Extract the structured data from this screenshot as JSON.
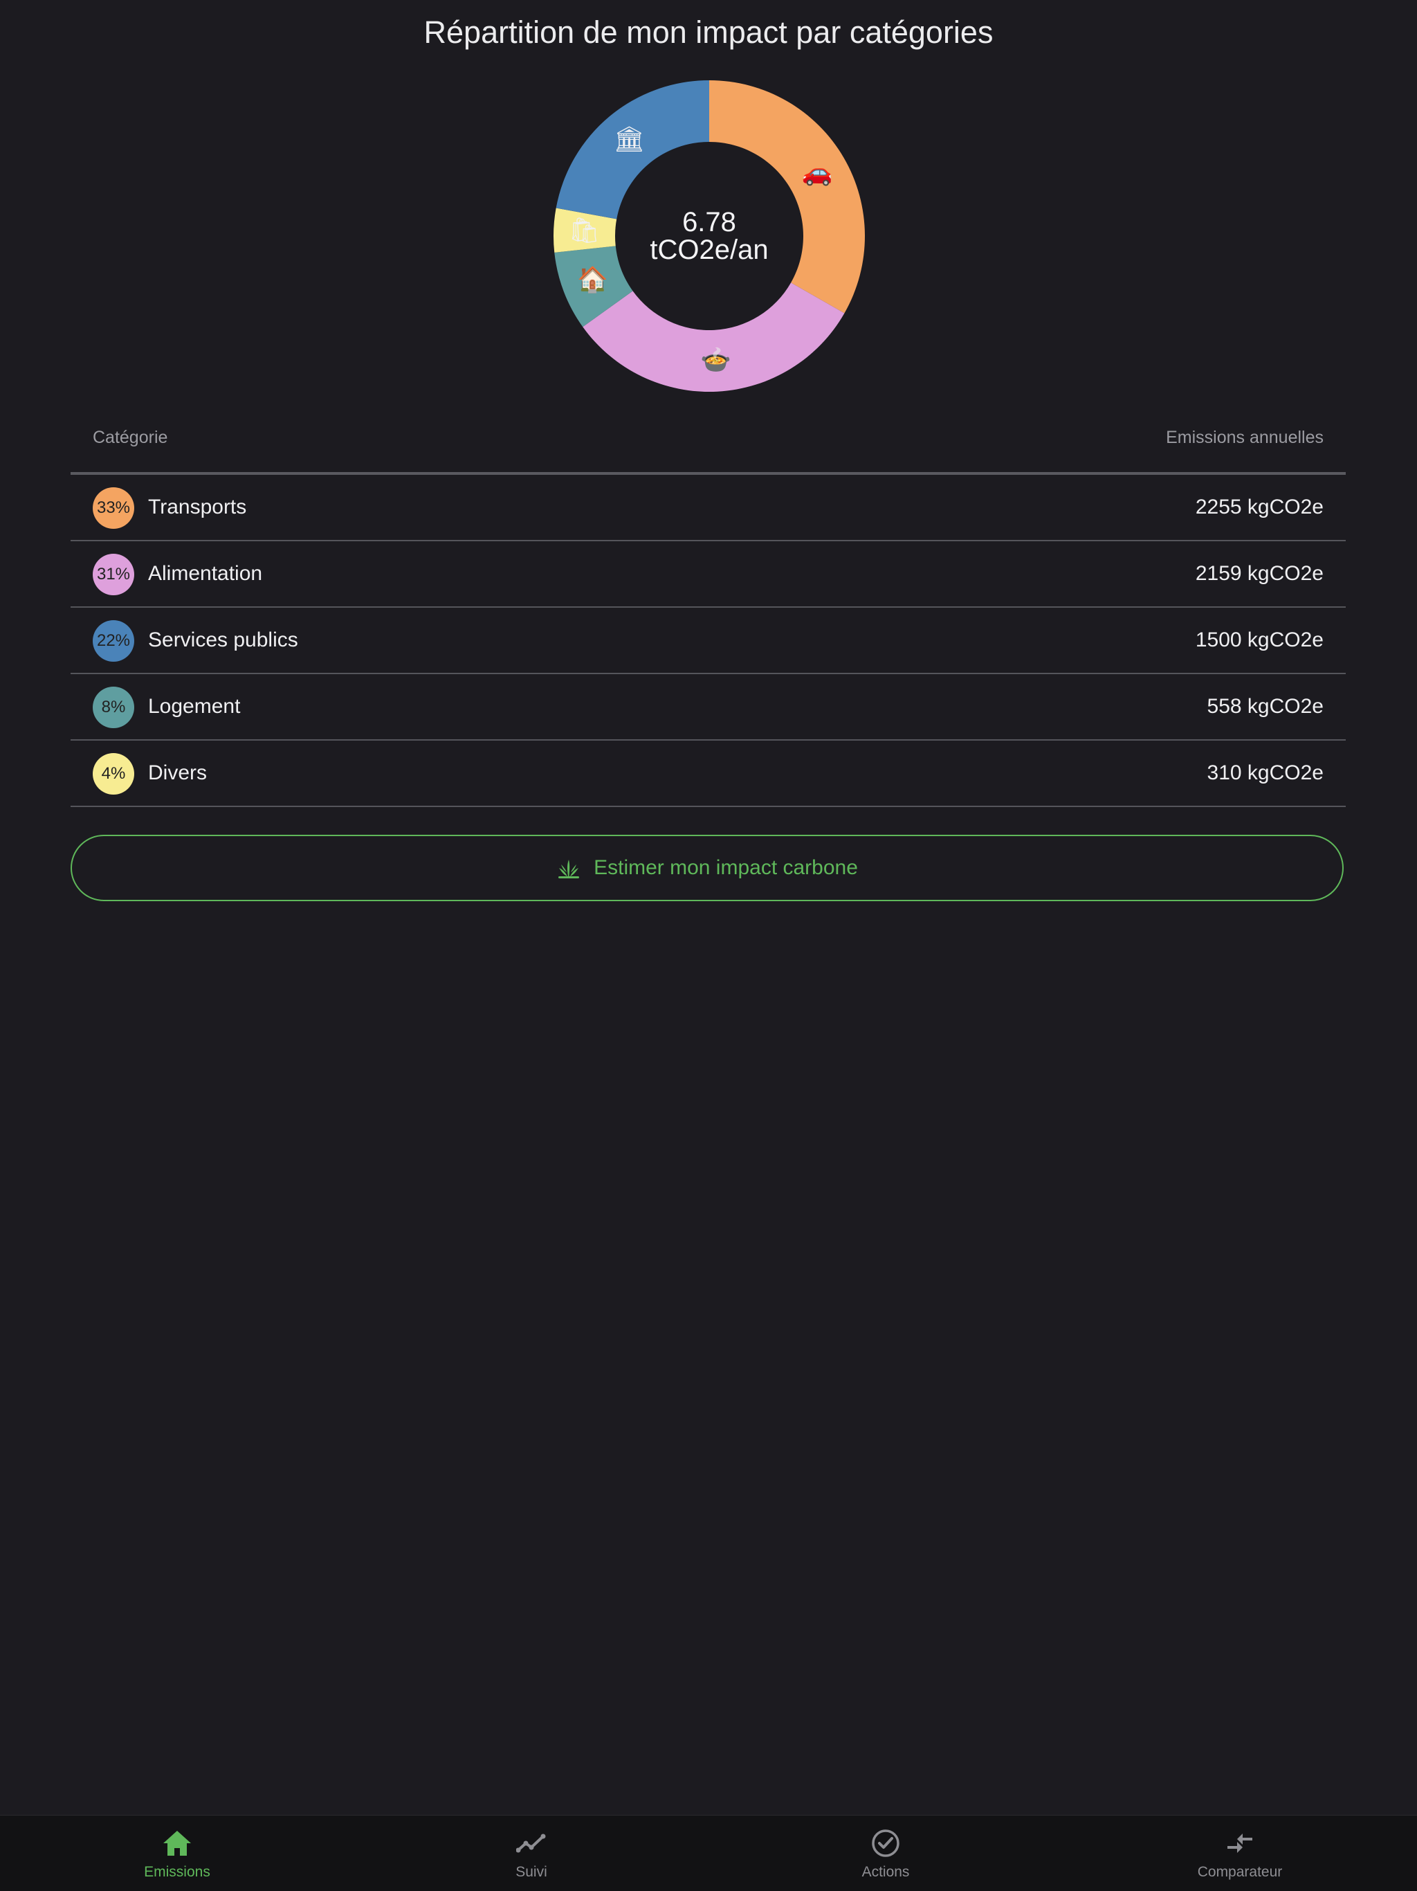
{
  "header": {
    "title": "Répartition de mon impact par catégories"
  },
  "chart_data": {
    "type": "pie",
    "variant": "donut",
    "center_value": "6.78",
    "center_unit": "tCO2e/an",
    "slices": [
      {
        "label": "Transports",
        "value": 2255,
        "percent": 33,
        "color": "#f4a461",
        "icon": "car-icon",
        "glyph": "🚗"
      },
      {
        "label": "Alimentation",
        "value": 2159,
        "percent": 31,
        "color": "#dea0dc",
        "icon": "food-bowl-icon",
        "glyph": "🍲"
      },
      {
        "label": "Logement",
        "value": 558,
        "percent": 8,
        "color": "#5f9ea0",
        "icon": "house-icon",
        "glyph": "🏠"
      },
      {
        "label": "Divers",
        "value": 310,
        "percent": 4,
        "color": "#f7ec92",
        "icon": "shopping-bags-icon",
        "glyph": "🛍"
      },
      {
        "label": "Services publics",
        "value": 1500,
        "percent": 22,
        "color": "#4a83b9",
        "icon": "public-building-icon",
        "glyph": "🏛"
      }
    ]
  },
  "table": {
    "col_category": "Catégorie",
    "col_emissions": "Emissions annuelles",
    "rows": [
      {
        "percent": "33%",
        "label": "Transports",
        "value": "2255 kgCO2e",
        "color": "#f4a461"
      },
      {
        "percent": "31%",
        "label": "Alimentation",
        "value": "2159 kgCO2e",
        "color": "#dea0dc"
      },
      {
        "percent": "22%",
        "label": "Services publics",
        "value": "1500 kgCO2e",
        "color": "#4a83b9"
      },
      {
        "percent": "8%",
        "label": "Logement",
        "value": "558 kgCO2e",
        "color": "#5f9ea0"
      },
      {
        "percent": "4%",
        "label": "Divers",
        "value": "310 kgCO2e",
        "color": "#f7ec92"
      }
    ]
  },
  "cta": {
    "label": "Estimer mon impact carbone",
    "icon": "sprout-icon"
  },
  "tabbar": {
    "tabs": [
      {
        "label": "Emissions",
        "icon": "home-icon",
        "active": true
      },
      {
        "label": "Suivi",
        "icon": "trend-line-icon",
        "active": false
      },
      {
        "label": "Actions",
        "icon": "check-circle-icon",
        "active": false
      },
      {
        "label": "Comparateur",
        "icon": "compare-arrows-icon",
        "active": false
      }
    ]
  },
  "colors": {
    "accent": "#5fb85a",
    "background": "#1c1b20",
    "tabbar": "#121214"
  }
}
